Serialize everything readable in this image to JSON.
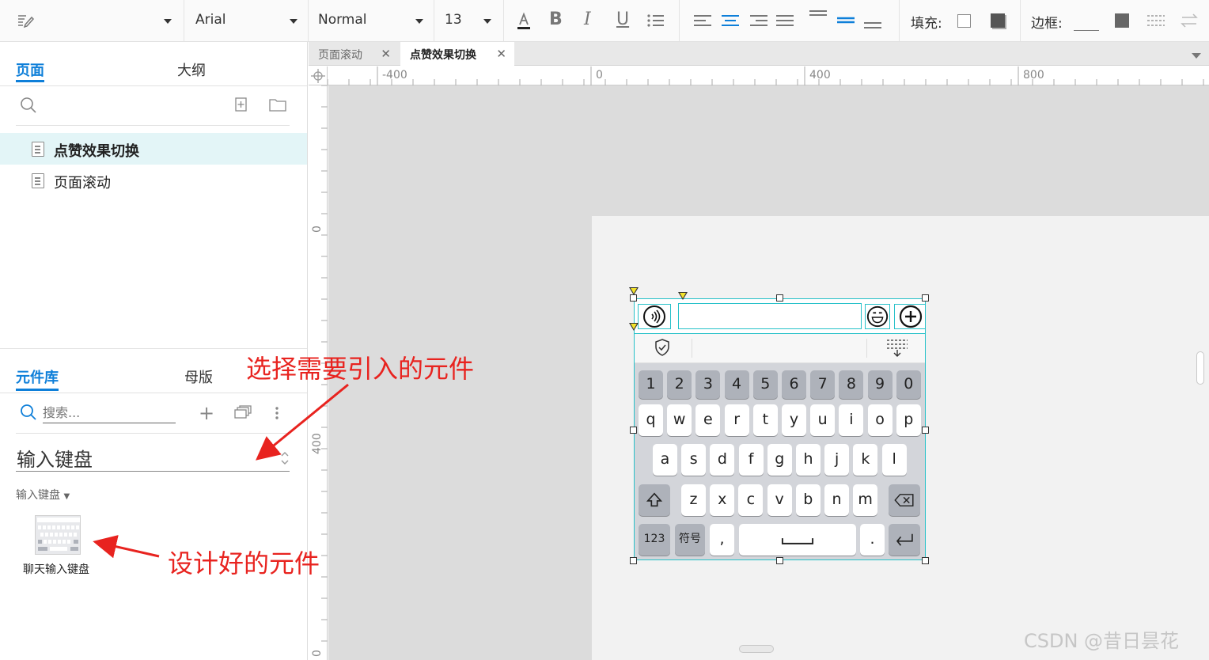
{
  "toolbar": {
    "font_family": "Arial",
    "text_style": "Normal",
    "font_size": "13",
    "fill_label": "填充:",
    "border_label": "边框:"
  },
  "pages_panel": {
    "tab_pages": "页面",
    "tab_outline": "大纲",
    "pages": [
      {
        "label": "点赞效果切换",
        "selected": true
      },
      {
        "label": "页面滚动",
        "selected": false
      }
    ]
  },
  "library_panel": {
    "tab_library": "元件库",
    "tab_masters": "母版",
    "search_placeholder": "搜索...",
    "library_name": "输入键盘",
    "section_label": "输入键盘",
    "widget_label": "聊天输入键盘"
  },
  "doc_tabs": [
    {
      "label": "页面滚动",
      "active": false
    },
    {
      "label": "点赞效果切换",
      "active": true
    }
  ],
  "rulers": {
    "h_labels": [
      "-400",
      "0",
      "400",
      "800"
    ],
    "v_labels": [
      "0",
      "400",
      "0"
    ]
  },
  "keyboard": {
    "row_numbers": [
      "1",
      "2",
      "3",
      "4",
      "5",
      "6",
      "7",
      "8",
      "9",
      "0"
    ],
    "row_q": [
      "q",
      "w",
      "e",
      "r",
      "t",
      "y",
      "u",
      "i",
      "o",
      "p"
    ],
    "row_a": [
      "a",
      "s",
      "d",
      "f",
      "g",
      "h",
      "j",
      "k",
      "l"
    ],
    "row_z": [
      "z",
      "x",
      "c",
      "v",
      "b",
      "n",
      "m"
    ],
    "key_123": "123",
    "key_symbol": "符号",
    "key_comma": ",",
    "key_period": "."
  },
  "annotations": {
    "choose_widget": "选择需要引入的元件",
    "designed_widget": "设计好的元件"
  },
  "watermark": "CSDN @昔日昙花",
  "colors": {
    "accent": "#0e7fd9",
    "selection": "#27c1c9",
    "annotation": "#e8231f"
  }
}
